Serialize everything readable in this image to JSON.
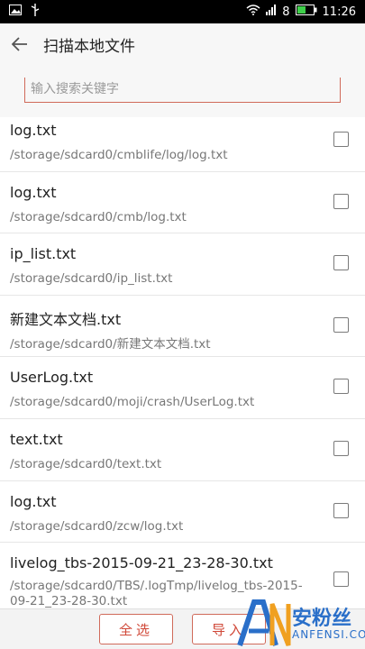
{
  "status_bar": {
    "signal_text": "8",
    "time": "11:26",
    "icons": [
      "image-icon",
      "usb-icon",
      "wifi-icon",
      "cell-signal-icon",
      "battery-icon"
    ]
  },
  "header": {
    "title": "扫描本地文件"
  },
  "search": {
    "placeholder": "输入搜索关键字",
    "value": ""
  },
  "files": [
    {
      "name": "log.txt",
      "path": "/storage/sdcard0/cmblife/log/log.txt",
      "checked": false
    },
    {
      "name": "log.txt",
      "path": "/storage/sdcard0/cmb/log.txt",
      "checked": false
    },
    {
      "name": "ip_list.txt",
      "path": "/storage/sdcard0/ip_list.txt",
      "checked": false
    },
    {
      "name": "新建文本文档.txt",
      "path": "/storage/sdcard0/新建文本文档.txt",
      "checked": false
    },
    {
      "name": "UserLog.txt",
      "path": "/storage/sdcard0/moji/crash/UserLog.txt",
      "checked": false
    },
    {
      "name": "text.txt",
      "path": "/storage/sdcard0/text.txt",
      "checked": false
    },
    {
      "name": "log.txt",
      "path": "/storage/sdcard0/zcw/log.txt",
      "checked": false
    },
    {
      "name": "livelog_tbs-2015-09-21_23-28-30.txt",
      "path": "/storage/sdcard0/TBS/.logTmp/livelog_tbs-2015-09-21_23-28-30.txt",
      "checked": false
    }
  ],
  "bottom": {
    "select_all_label": "全选",
    "import_label": "导入"
  },
  "watermark": {
    "text": "安粉丝",
    "sub": "ANFENSI.COM"
  },
  "colors": {
    "accent": "#d04838",
    "watermark": "#2a6fc9"
  }
}
